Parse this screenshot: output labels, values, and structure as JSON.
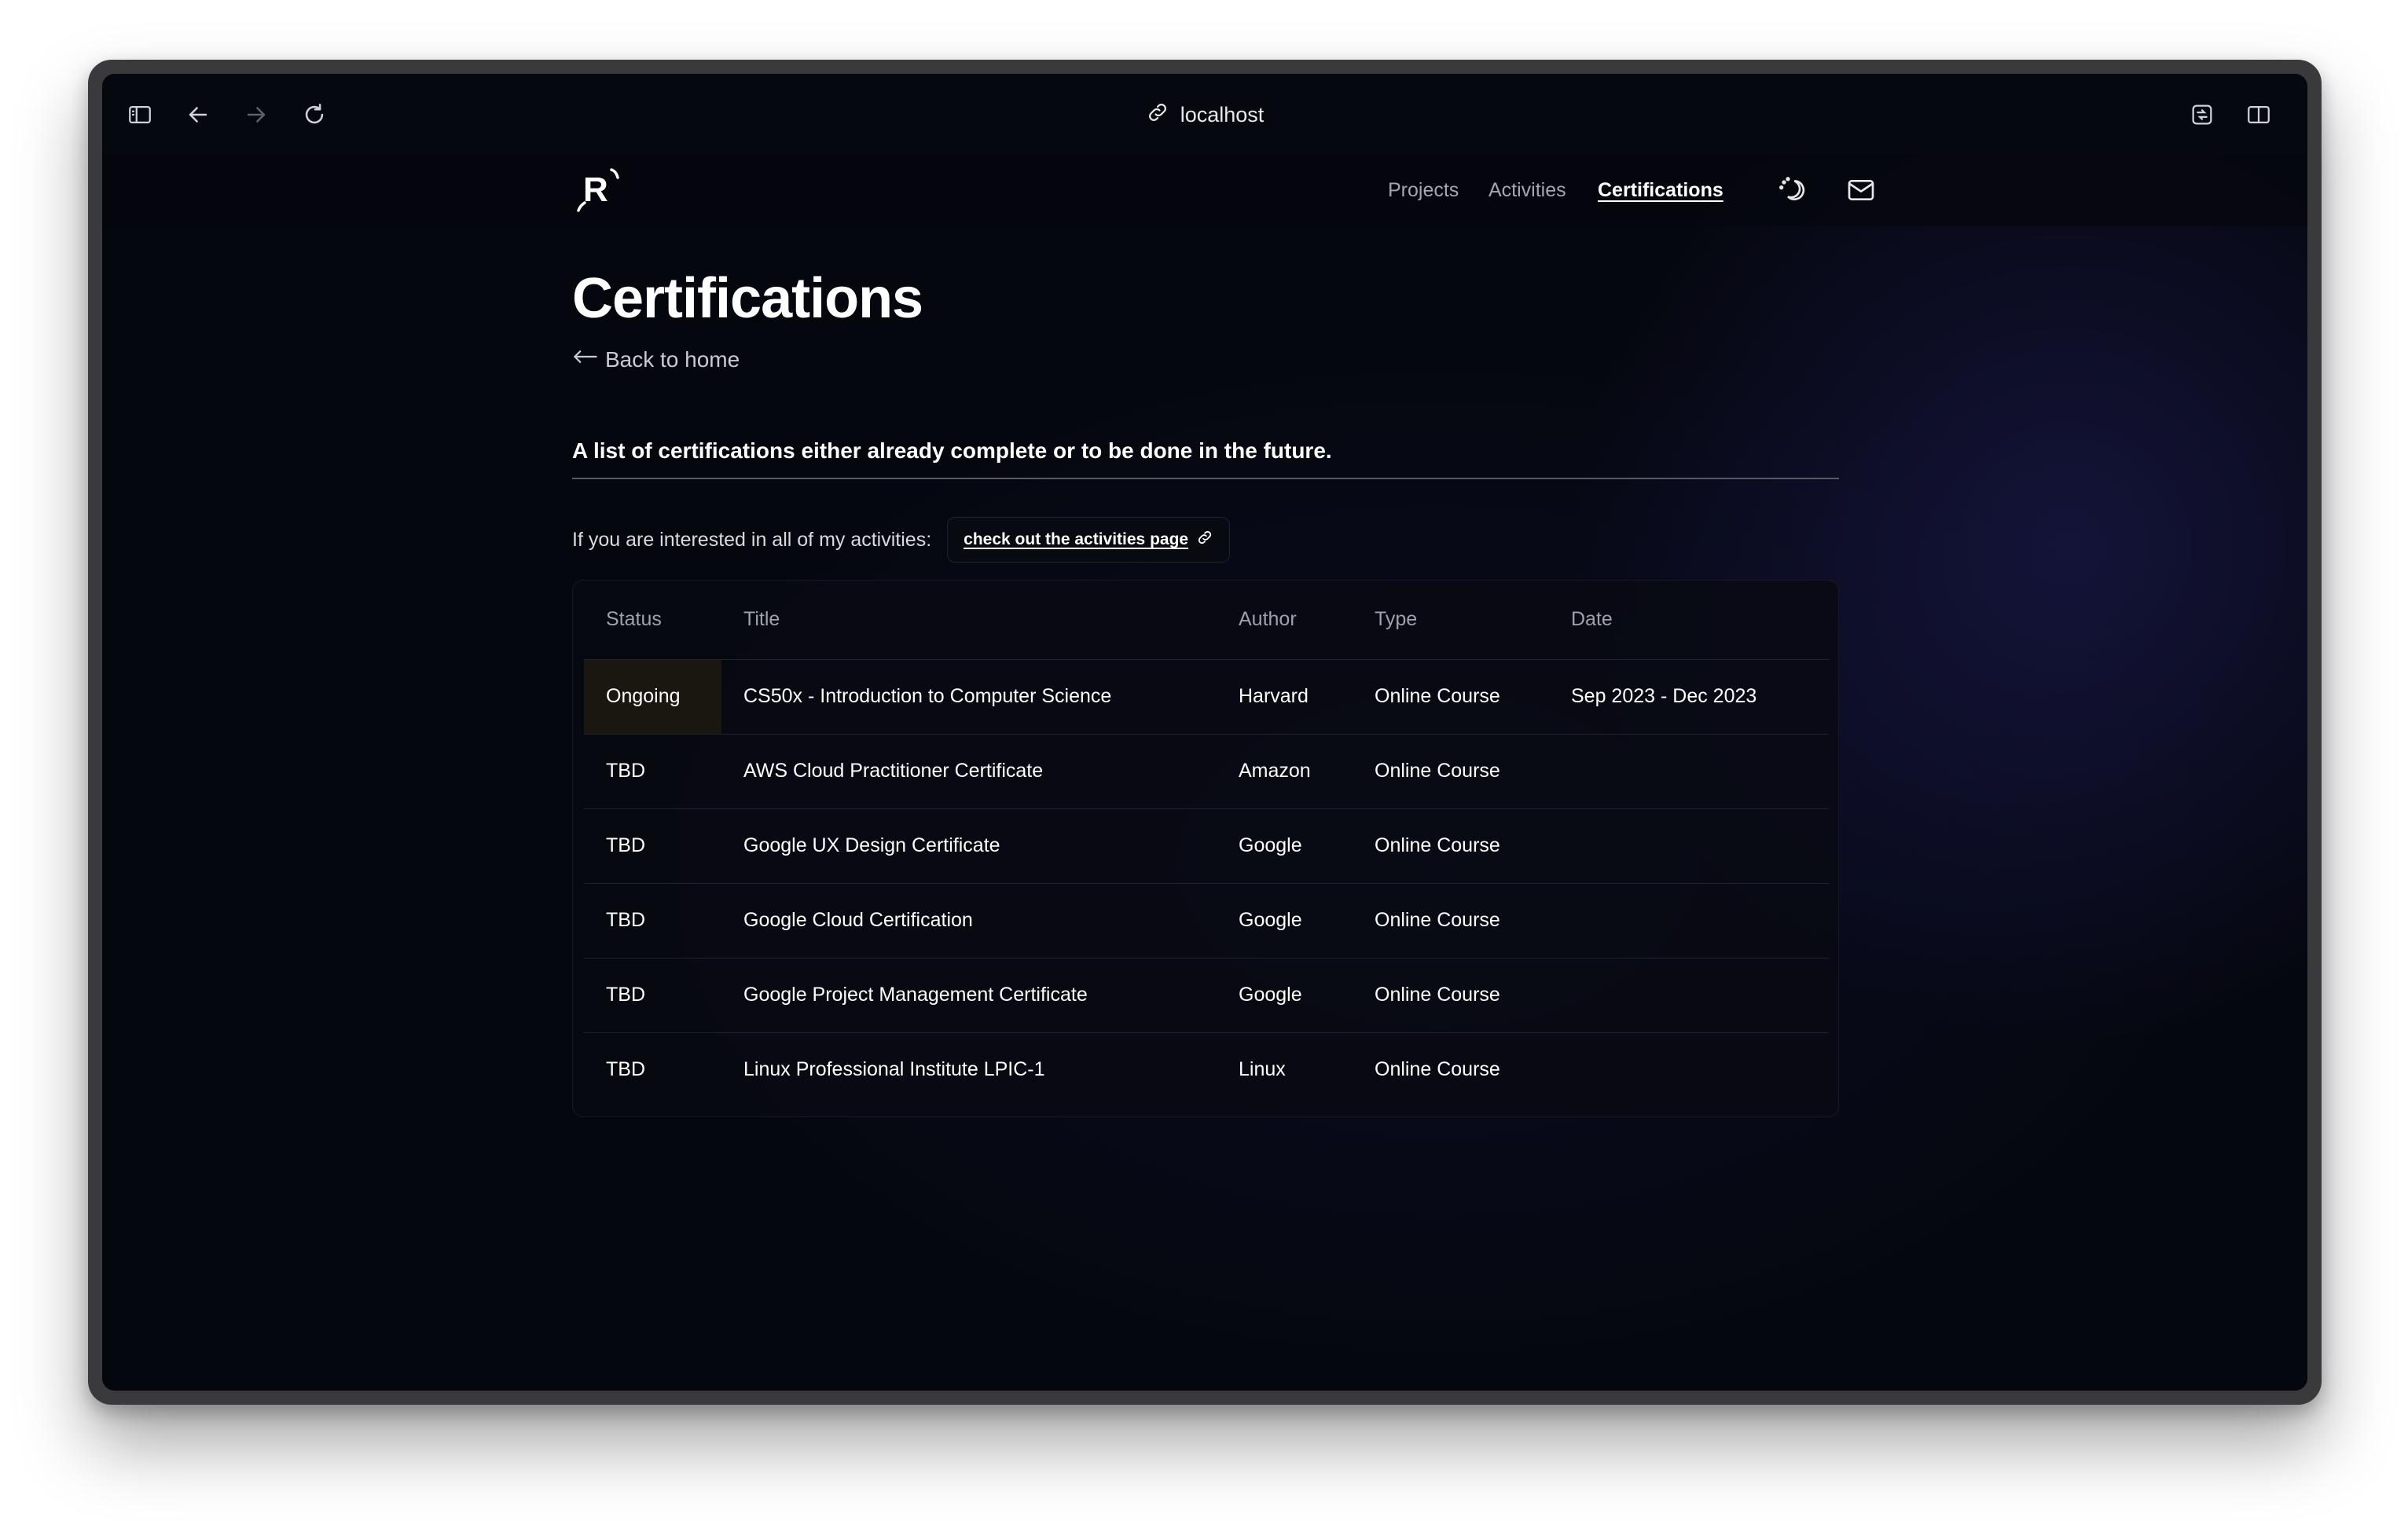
{
  "browser": {
    "url": "localhost"
  },
  "header": {
    "logo_text": "R",
    "nav": [
      {
        "label": "Projects",
        "active": false
      },
      {
        "label": "Activities",
        "active": false
      },
      {
        "label": "Certifications",
        "active": true
      }
    ],
    "icons": [
      "theme-toggle-icon",
      "mail-icon"
    ]
  },
  "page": {
    "title": "Certifications",
    "back_label": "Back to home",
    "intro": "A list of certifications either already complete or to be done in the future.",
    "activities_text": "If you are interested in all of my activities:",
    "activities_link": "check out the activities page"
  },
  "table": {
    "columns": [
      "Status",
      "Title",
      "Author",
      "Type",
      "Date"
    ],
    "rows": [
      {
        "status": "Ongoing",
        "title": "CS50x - Introduction to Computer Science",
        "author": "Harvard",
        "type": "Online Course",
        "date": "Sep 2023 - Dec 2023"
      },
      {
        "status": "TBD",
        "title": "AWS Cloud Practitioner Certificate",
        "author": "Amazon",
        "type": "Online Course",
        "date": ""
      },
      {
        "status": "TBD",
        "title": "Google UX Design Certificate",
        "author": "Google",
        "type": "Online Course",
        "date": ""
      },
      {
        "status": "TBD",
        "title": "Google Cloud Certification",
        "author": "Google",
        "type": "Online Course",
        "date": ""
      },
      {
        "status": "TBD",
        "title": "Google Project Management Certificate",
        "author": "Google",
        "type": "Online Course",
        "date": ""
      },
      {
        "status": "TBD",
        "title": "Linux Professional Institute LPIC-1",
        "author": "Linux",
        "type": "Online Course",
        "date": ""
      }
    ]
  },
  "colors": {
    "background": "#05070f",
    "text": "#ffffff",
    "muted": "#9ea2ad",
    "ongoing_highlight": "#1a1710"
  }
}
